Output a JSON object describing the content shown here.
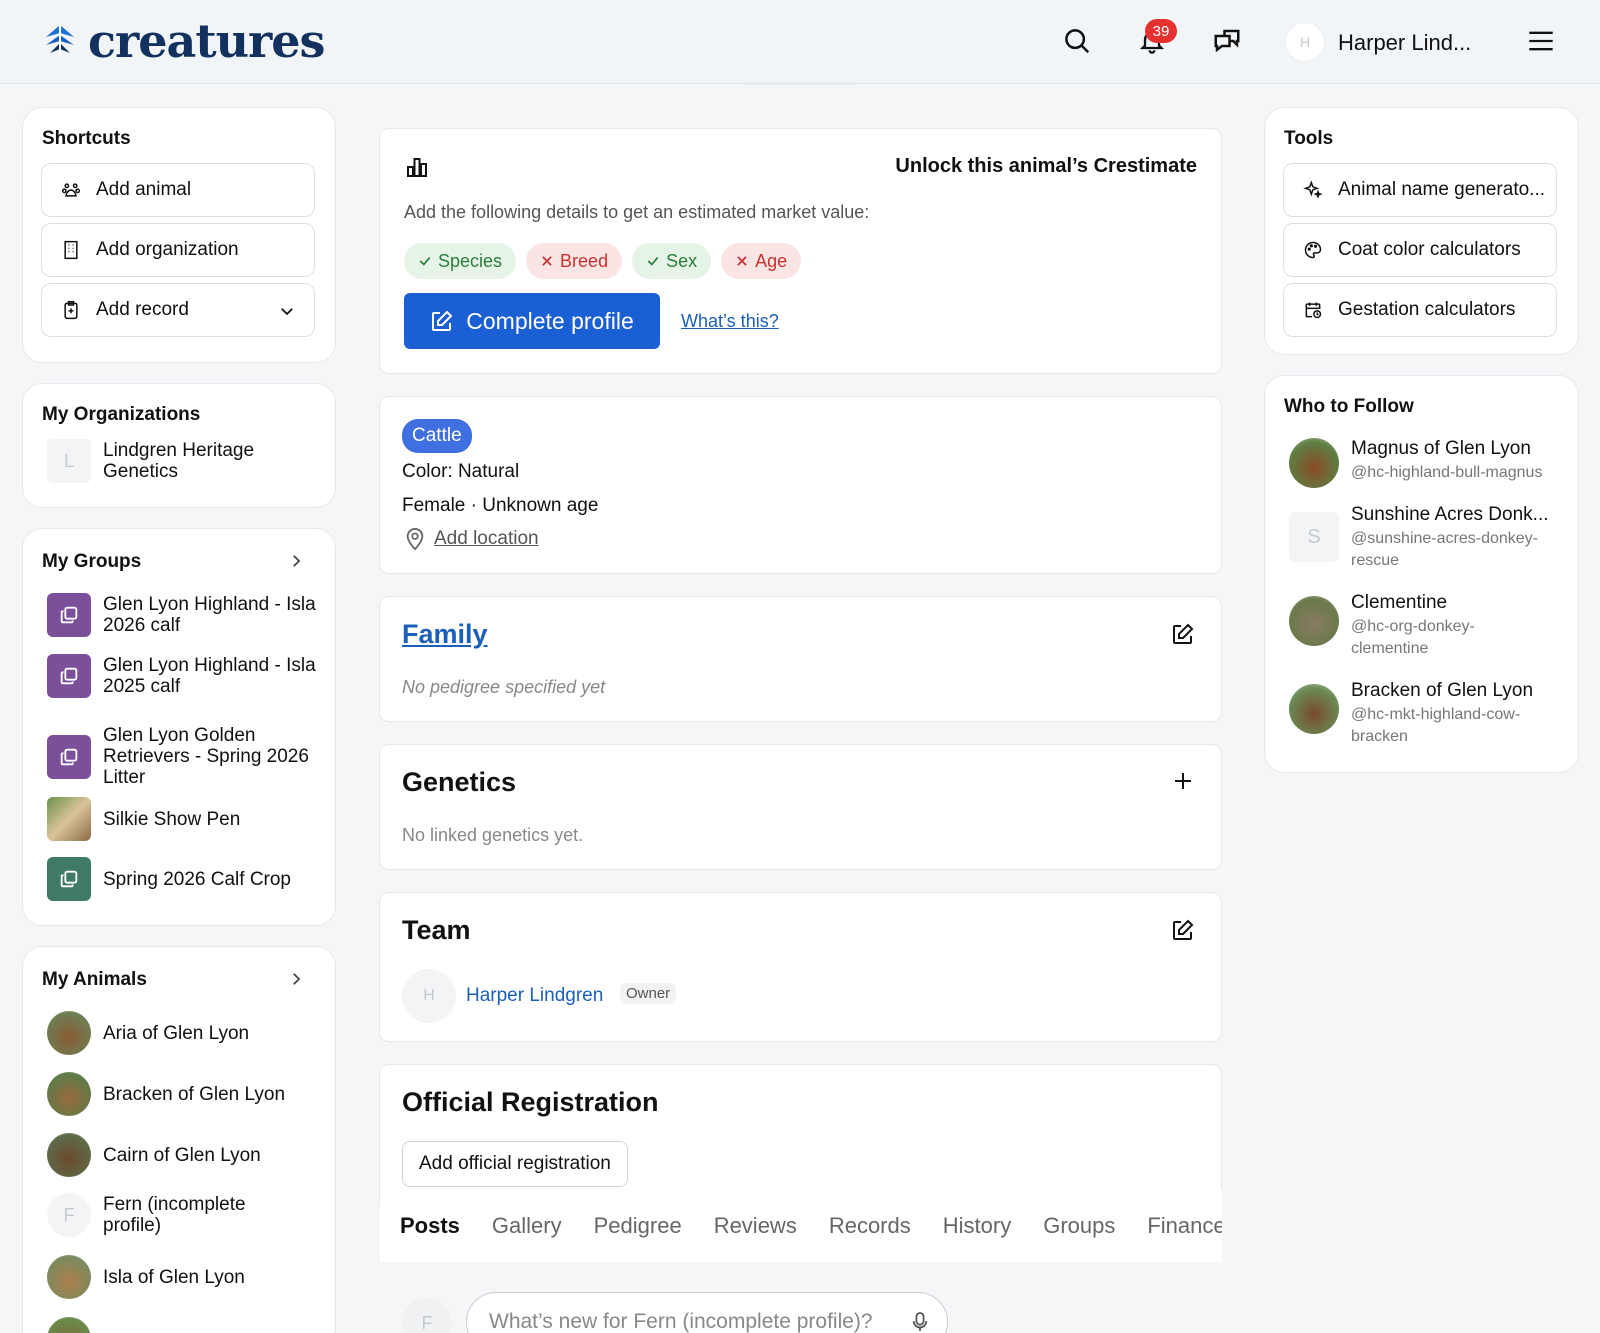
{
  "header": {
    "logo_text": "creatures",
    "notification_count": "39",
    "avatar_initial": "H",
    "user_name": "Harper Lind..."
  },
  "shortcuts": {
    "title": "Shortcuts",
    "items": [
      {
        "label": "Add animal",
        "icon": "paw-icon"
      },
      {
        "label": "Add organization",
        "icon": "building-icon"
      },
      {
        "label": "Add record",
        "icon": "clipboard-plus-icon"
      }
    ]
  },
  "organizations": {
    "title": "My Organizations",
    "items": [
      {
        "initial": "L",
        "label": "Lindgren Heritage Genetics"
      }
    ]
  },
  "groups": {
    "title": "My Groups",
    "items": [
      {
        "label": "Glen Lyon Highland - Isla 2026 calf"
      },
      {
        "label": "Glen Lyon Highland - Isla 2025 calf"
      },
      {
        "label": "Glen Lyon Golden Retrievers - Spring 2026 Litter"
      },
      {
        "label": "Silkie Show Pen"
      },
      {
        "label": "Spring 2026 Calf Crop"
      }
    ]
  },
  "animals": {
    "title": "My Animals",
    "items": [
      {
        "label": "Aria of Glen Lyon"
      },
      {
        "label": "Bracken of Glen Lyon"
      },
      {
        "label": "Cairn of Glen Lyon"
      },
      {
        "label": "Fern (incomplete profile)",
        "initial": "F"
      },
      {
        "label": "Isla of Glen Lyon"
      }
    ]
  },
  "crestimate": {
    "title": "Unlock this animal’s Crestimate",
    "description": "Add the following details to get an estimated market value:",
    "pills": [
      {
        "label": "Species",
        "status": "ok"
      },
      {
        "label": "Breed",
        "status": "missing"
      },
      {
        "label": "Sex",
        "status": "ok"
      },
      {
        "label": "Age",
        "status": "missing"
      }
    ],
    "cta": "Complete profile",
    "help_link": "What’s this?"
  },
  "profile": {
    "species_tag": "Cattle",
    "color_line": "Color: Natural",
    "sex_age_line": "Female · Unknown age",
    "location_link": "Add location"
  },
  "family": {
    "title": "Family",
    "empty": "No pedigree specified yet"
  },
  "genetics": {
    "title": "Genetics",
    "empty": "No linked genetics yet."
  },
  "team": {
    "title": "Team",
    "members": [
      {
        "initial": "H",
        "name": "Harper Lindgren",
        "role": "Owner"
      }
    ]
  },
  "registration": {
    "title": "Official Registration",
    "button": "Add official registration"
  },
  "tabs": [
    "Posts",
    "Gallery",
    "Pedigree",
    "Reviews",
    "Records",
    "History",
    "Groups",
    "Finances"
  ],
  "composer": {
    "avatar_initial": "F",
    "placeholder": "What’s new for Fern (incomplete profile)?"
  },
  "tools": {
    "title": "Tools",
    "items": [
      {
        "label": "Animal name generato...",
        "icon": "sparkle-icon"
      },
      {
        "label": "Coat color calculators",
        "icon": "palette-icon"
      },
      {
        "label": "Gestation calculators",
        "icon": "calendar-clock-icon"
      }
    ]
  },
  "who_to_follow": {
    "title": "Who to Follow",
    "items": [
      {
        "name": "Magnus of Glen Lyon",
        "handle": "@hc-highland-bull-magnus"
      },
      {
        "name": "Sunshine Acres Donk...",
        "handle": "@sunshine-acres-donkey-rescue",
        "initial": "S"
      },
      {
        "name": "Clementine",
        "handle": "@hc-org-donkey-clementine"
      },
      {
        "name": "Bracken of Glen Lyon",
        "handle": "@hc-mkt-highland-cow-bracken"
      }
    ]
  },
  "colors": {
    "brand": "#12315f",
    "primary_button": "#1a5fd3",
    "link": "#1a5fb8",
    "badge": "#e5312f",
    "group_purple": "#7c4f9b",
    "group_green": "#3f7a66"
  }
}
